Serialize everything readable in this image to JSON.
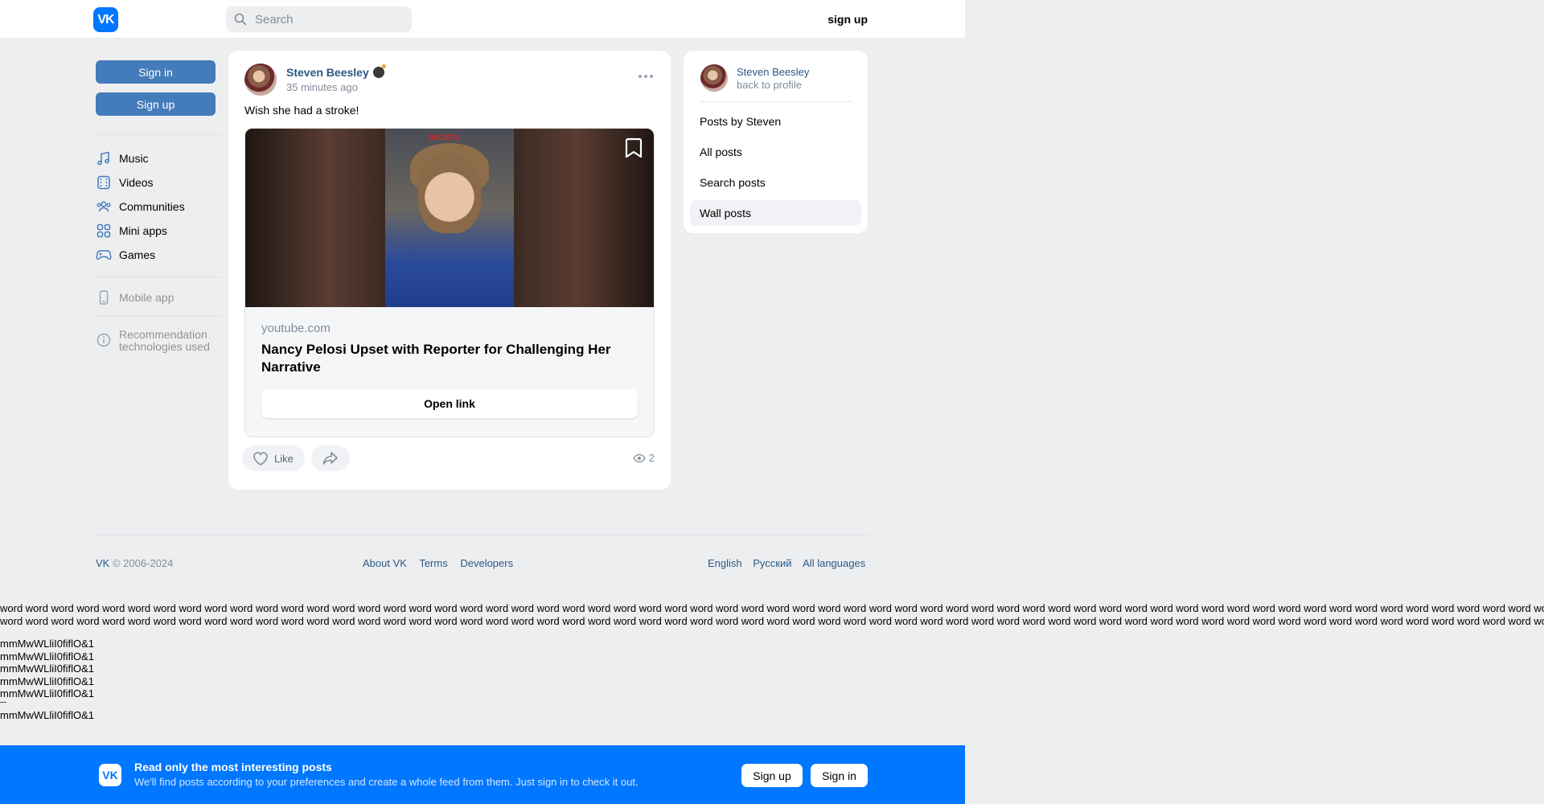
{
  "header": {
    "logo": "VK",
    "search_placeholder": "Search",
    "signup": "sign up"
  },
  "sidebar": {
    "signin": "Sign in",
    "signup": "Sign up",
    "items": [
      {
        "label": "Music",
        "icon": "music-icon"
      },
      {
        "label": "Videos",
        "icon": "video-icon"
      },
      {
        "label": "Communities",
        "icon": "communities-icon"
      },
      {
        "label": "Mini apps",
        "icon": "mini-apps-icon"
      },
      {
        "label": "Games",
        "icon": "gamepad-icon"
      }
    ],
    "mobile_app": "Mobile app",
    "recommendation_line1": "Recommendation",
    "recommendation_line2": "technologies used"
  },
  "post": {
    "author": "Steven Beesley",
    "time": "35 minutes ago",
    "text": "Wish she had a stroke!",
    "thumb_badge": "SHORTS",
    "link_domain": "youtube.com",
    "link_title": "Nancy Pelosi Upset with Reporter for Challenging Her Narrative",
    "open_link": "Open link",
    "like": "Like",
    "views": "2"
  },
  "profile_card": {
    "name": "Steven Beesley",
    "back": "back to profile",
    "menu": [
      "Posts by Steven",
      "All posts",
      "Search posts",
      "Wall posts"
    ],
    "active_index": 3
  },
  "footer": {
    "copyright_brand": "VK",
    "copyright": "© 2006-2024",
    "links": [
      "About VK",
      "Terms",
      "Developers"
    ],
    "languages": [
      "English",
      "Русский",
      "All languages"
    ]
  },
  "filler": {
    "word_line": "word word word word word word word word word word word word word word word word word word word word word word word word word word word word word word word word word word word word word word word word word word word word word word word word word word word word word word word word word word word word word",
    "glyph_line": "mmMwWLliI0fiflO&1"
  },
  "banner": {
    "title": "Read only the most interesting posts",
    "subtitle": "We'll find posts according to your preferences and create a whole feed from them. Just sign in to check it out.",
    "signup": "Sign up",
    "signin": "Sign in"
  },
  "colors": {
    "accent": "#0077ff",
    "link": "#2a5885",
    "button": "#447bba",
    "page_bg": "#edeef0"
  }
}
